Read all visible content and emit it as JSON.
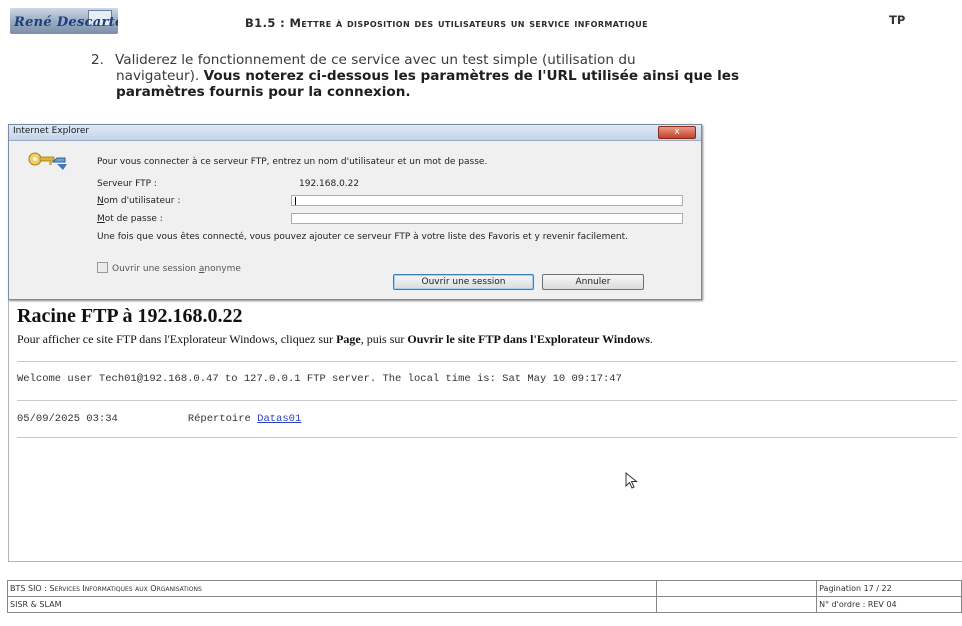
{
  "header": {
    "logo_text": "René Descartes",
    "title": "B1.5 : Mettre à disposition des utilisateurs un service informatique",
    "tag": "TP"
  },
  "instruction": {
    "number": "2.",
    "text_plain": "Validerez le fonctionnement de ce service avec un test simple (utilisation du",
    "text_plain_2": "navigateur).",
    "text_bold": "Vous noterez ci-dessous les paramètres de l'URL utilisée ainsi que les",
    "text_bold_2": "paramètres fournis pour la connexion."
  },
  "dialog": {
    "title": "Internet Explorer",
    "close_label": "x",
    "prompt": "Pour vous connecter à ce serveur FTP, entrez un nom d'utilisateur et un mot de passe.",
    "server_label": "Serveur FTP :",
    "server_value": "192.168.0.22",
    "username_label_u": "N",
    "username_label_rest": "om d'utilisateur :",
    "username_value": "",
    "password_label_u": "M",
    "password_label_rest": "ot de passe :",
    "password_value": "",
    "note": "Une fois que vous êtes connecté, vous pouvez ajouter ce serveur FTP à votre liste des Favoris et y revenir facilement.",
    "anonymous_label_pre": "Ouvrir une session ",
    "anonymous_label_u": "a",
    "anonymous_label_rest": "nonyme",
    "anonymous_checked": false,
    "login_button": "Ouvrir une session",
    "cancel_button": "Annuler"
  },
  "ftp_page": {
    "heading": "Racine FTP à 192.168.0.22",
    "instr_pre": "Pour afficher ce site FTP dans l'Explorateur Windows, cliquez sur ",
    "instr_page": "Page",
    "instr_mid": ", puis sur ",
    "instr_open": "Ouvrir le site FTP dans l'Explorateur Windows",
    "instr_end": ".",
    "welcome": "Welcome user Tech01@192.168.0.47 to 127.0.0.1 FTP server. The local time is: Sat May 10 09:17:47",
    "entries": [
      {
        "date": "05/09/2025 03:34",
        "type": "Répertoire",
        "name": "Datas01"
      }
    ]
  },
  "footer": {
    "row1_left": "BTS SIO : Services Informatiques aux Organisations",
    "row1_right": "Pagination 17 / 22",
    "row2_left": "SISR & SLAM",
    "row2_right": "N° d'ordre : REV 04"
  }
}
